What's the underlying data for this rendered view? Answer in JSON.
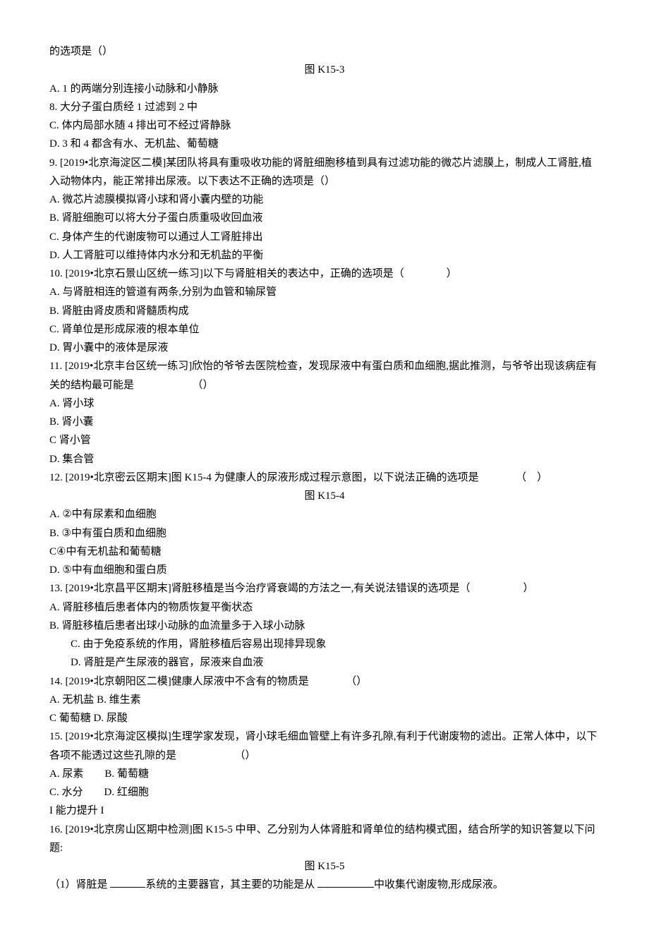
{
  "intro": {
    "line1": "的选项是（）",
    "fig1": "图 K15-3"
  },
  "opt_a": "A. 1 的两端分别连接小动脉和小静脉",
  "opt_b": "8. 大分子蛋白质经 1 过滤到 2 中",
  "opt_c": "C. 体内局部水随 4 排出可不经过肾静脉",
  "opt_d": "D. 3 和 4 都含有水、无机盐、葡萄糖",
  "q9": {
    "stem1": "9. [2019•北京海淀区二模]某团队将具有重吸收功能的肾脏细胞移植到具有过滤功能的微芯片滤膜上，制成人工肾脏,植",
    "stem2": "入动物体内，能正常排出尿液。以下表达不正确的选项是（）",
    "a": "A. 微芯片滤膜模拟肾小球和肾小囊内壁的功能",
    "b": "B. 肾脏细胞可以将大分子蛋白质重吸收回血液",
    "c": "C. 身体产生的代谢废物可以通过人工肾脏排出",
    "d": "D. 人工肾脏可以维持体内水分和无机盐的平衡"
  },
  "q10": {
    "stem": "10. [2019•北京石景山区统一练习]以下与肾脏相关的表达中，正确的选项是（　　　　）",
    "a": "A. 与肾脏相连的管道有两条,分别为血管和输尿管",
    "b": "B. 肾脏由肾皮质和肾髓质构成",
    "c": "C. 肾单位是形成尿液的根本单位",
    "d": "D. 胃小囊中的液体是尿液"
  },
  "q11": {
    "stem1": "11. [2019•北京丰台区统一练习]欣怡的爷爷去医院检查，发现尿液中有蛋白质和血细胞,据此推测，与爷爷出现该病症有",
    "stem2": "关的结构最可能是　　　　　　（）",
    "a": "A. 肾小球",
    "b": "B. 肾小囊",
    "c": "C 肾小管",
    "d": "D. 集合管"
  },
  "q12": {
    "stem": "12. [2019•北京密云区期末]图 K15-4 为健康人的尿液形成过程示意图，以下说法正确的选项是　　　　（　）",
    "fig": "图 K15-4",
    "a": "A. ②中有尿素和血细胞",
    "b": "B. ③中有蛋白质和血细胞",
    "c": "C④中有无机盐和葡萄糖",
    "d": "D. ⑤中有血细胞和蛋白质"
  },
  "q13": {
    "stem": "13. [2019•北京昌平区期末]肾脏移植是当今治疗肾衰竭的方法之一,有关说法错误的选项是（　　　　　）",
    "a": "A. 肾脏移植后患者体内的物质恢复平衡状态",
    "b": "B. 肾脏移植后患者出球小动脉的血流量多于入球小动脉",
    "c": "C. 由于免疫系统的作用，肾脏移植后容易出现排异现象",
    "d": "D. 肾脏是产生尿液的器官，尿液来自血液"
  },
  "q14": {
    "stem": "14. [2019•北京朝阳区二模]健康人尿液中不含有的物质是　　　　（）",
    "ab": "A. 无机盐 B. 维生素",
    "cd": "C 葡萄糖 D. 尿酸"
  },
  "q15": {
    "stem1": "15. [2019•北京海淀区模拟]生理学家发现，肾小球毛细血管壁上有许多孔隙,有利于代谢废物的滤出。正常人体中，以下",
    "stem2": "各项不能透过这些孔隙的是　　　　　　（）",
    "ab": "A. 尿素　　B. 葡萄糖",
    "cd": "C. 水分　　D. 红细胞"
  },
  "section": "I 能力提升 I",
  "q16": {
    "stem1": "16. [2019•北京房山区期中检测]图 K15-5 中甲、乙分别为人体肾脏和肾单位的结构模式图，结合所学的知识答复以下问",
    "stem2": "题:",
    "fig": "图 K15-5",
    "sub1a": "（1）肾脏是 ",
    "sub1b": "系统的主要器官，其主要的功能是从 ",
    "sub1c": "中收集代谢废物,形成尿液。"
  }
}
